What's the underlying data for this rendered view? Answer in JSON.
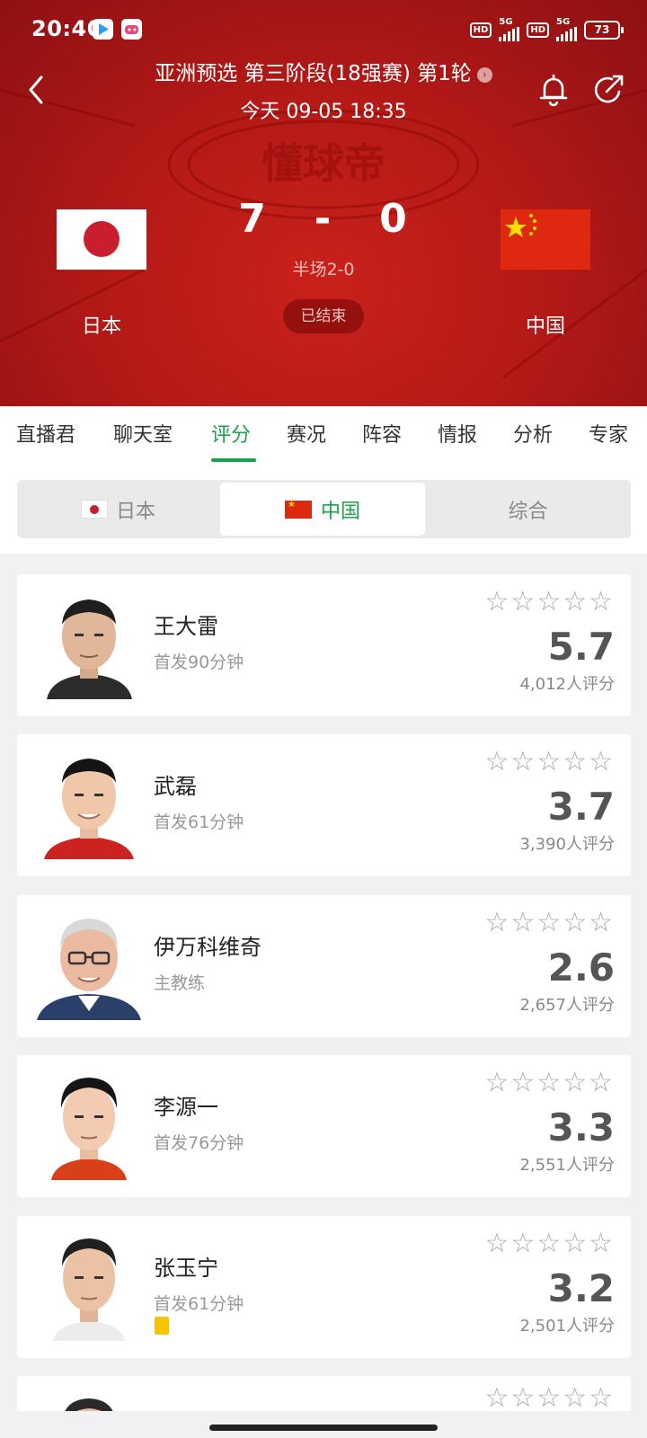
{
  "status_bar": {
    "time": "20:40",
    "hd": "HD",
    "network": "5G",
    "battery": "73"
  },
  "match": {
    "title": "亚洲预选 第三阶段(18强赛) 第1轮",
    "datetime": "今天 09-05 18:35",
    "home_team": "日本",
    "away_team": "中国",
    "home_score": "7",
    "separator": "-",
    "away_score": "0",
    "halftime": "半场2-0",
    "status": "已结束",
    "watermark": "懂球帝"
  },
  "tabs": [
    {
      "label": "直播君"
    },
    {
      "label": "聊天室"
    },
    {
      "label": "评分"
    },
    {
      "label": "赛况"
    },
    {
      "label": "阵容"
    },
    {
      "label": "情报"
    },
    {
      "label": "分析"
    },
    {
      "label": "专家"
    }
  ],
  "active_tab": "评分",
  "segment": {
    "options": [
      {
        "label": "日本"
      },
      {
        "label": "中国"
      },
      {
        "label": "综合"
      }
    ],
    "selected": "中国"
  },
  "players": [
    {
      "name": "王大雷",
      "info": "首发90分钟",
      "rating": "5.7",
      "count": "4,012人评分",
      "yellow_card": false
    },
    {
      "name": "武磊",
      "info": "首发61分钟",
      "rating": "3.7",
      "count": "3,390人评分",
      "yellow_card": false
    },
    {
      "name": "伊万科维奇",
      "info": "主教练",
      "rating": "2.6",
      "count": "2,657人评分",
      "yellow_card": false
    },
    {
      "name": "李源一",
      "info": "首发76分钟",
      "rating": "3.3",
      "count": "2,551人评分",
      "yellow_card": false
    },
    {
      "name": "张玉宁",
      "info": "首发61分钟",
      "rating": "3.2",
      "count": "2,501人评分",
      "yellow_card": true
    }
  ],
  "icons": {
    "back": "back-arrow-icon",
    "bell": "bell-icon",
    "share": "share-icon",
    "star": "star-outline-icon"
  },
  "colors": {
    "accent": "#1aa34a",
    "header": "#b51a17",
    "yellow_card": "#f7c500"
  }
}
